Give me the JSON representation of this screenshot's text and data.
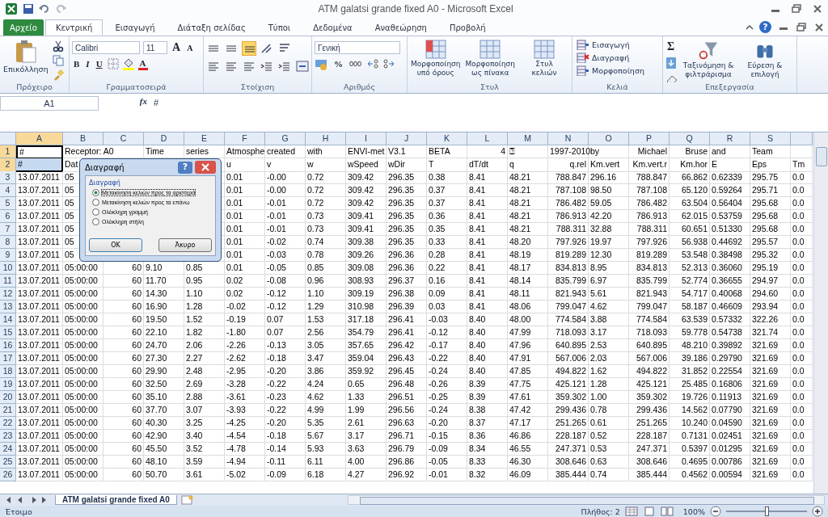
{
  "window": {
    "title": "ATM galatsi grande fixed A0  -  Microsoft Excel"
  },
  "file_tab": "Αρχείο",
  "tabs": [
    {
      "label": "Κεντρική",
      "selected": true
    },
    {
      "label": "Εισαγωγή",
      "selected": false
    },
    {
      "label": "Διάταξη σελίδας",
      "selected": false
    },
    {
      "label": "Τύποι",
      "selected": false
    },
    {
      "label": "Δεδομένα",
      "selected": false
    },
    {
      "label": "Αναθεώρηση",
      "selected": false
    },
    {
      "label": "Προβολή",
      "selected": false
    }
  ],
  "help": "?",
  "ribbon": {
    "clipboard": {
      "label": "Πρόχειρο",
      "paste": "Επικόλληση"
    },
    "font": {
      "label": "Γραμματοσειρά",
      "name": "Calibri",
      "size": "11",
      "grow": "A",
      "shrink": "A",
      "bold": "B",
      "italic": "I",
      "underline": "U",
      "font_color_button": "A"
    },
    "alignment": {
      "label": "Στοίχιση"
    },
    "number": {
      "label": "Αριθμός",
      "format": "Γενική",
      "percent": "%",
      "thousands": "000"
    },
    "styles": {
      "label": "Στυλ",
      "buttons": [
        "Μορφοποίηση\nυπό όρους",
        "Μορφοποίηση\nως πίνακα",
        "Στυλ\nκελιών"
      ]
    },
    "cells": {
      "label": "Κελιά",
      "buttons": [
        "Εισαγωγή",
        "Διαγραφή",
        "Μορφοποίηση"
      ]
    },
    "editing": {
      "label": "Επεξεργασία",
      "sum": "Σ",
      "buttons": [
        "Ταξινόμηση &\nφιλτράρισμα",
        "Εύρεση &\nεπιλογή"
      ]
    }
  },
  "formula_bar": {
    "name_box": "A1",
    "fx": "fx",
    "value": "#"
  },
  "columns": [
    {
      "letter": "A",
      "selected": true
    },
    {
      "letter": "B",
      "selected": false
    },
    {
      "letter": "C",
      "selected": false
    },
    {
      "letter": "D",
      "selected": false
    },
    {
      "letter": "E",
      "selected": false
    },
    {
      "letter": "F",
      "selected": false
    },
    {
      "letter": "G",
      "selected": false
    },
    {
      "letter": "H",
      "selected": false
    },
    {
      "letter": "I",
      "selected": false
    },
    {
      "letter": "J",
      "selected": false
    },
    {
      "letter": "K",
      "selected": false
    },
    {
      "letter": "L",
      "selected": false
    },
    {
      "letter": "M",
      "selected": false
    },
    {
      "letter": "N",
      "selected": false
    },
    {
      "letter": "O",
      "selected": false
    },
    {
      "letter": "P",
      "selected": false
    },
    {
      "letter": "Q",
      "selected": false
    },
    {
      "letter": "R",
      "selected": false
    },
    {
      "letter": "S",
      "selected": false
    }
  ],
  "rows": [
    {
      "number": "1",
      "selected": true,
      "cells": [
        "#",
        "Receptor: A0",
        null,
        "Time",
        "series",
        "Atmosphe",
        "created",
        "with",
        "ENVI-met",
        "V3.1",
        "BETA",
        "4",
        "⍰",
        "1997-2010",
        "by",
        "Michael",
        "Bruse",
        "and",
        "Team",
        null
      ]
    },
    {
      "number": "2",
      "selected": true,
      "cells": [
        "#",
        "Dat",
        null,
        null,
        null,
        "u",
        "v",
        "w",
        "wSpeed",
        "wDir",
        "T",
        "dT/dt",
        "q",
        "q.rel",
        "Km.vert",
        "Km.vert.r",
        "Km.hor",
        "E",
        "Eps",
        "Tm"
      ]
    },
    {
      "number": "3",
      "selected": false,
      "cells": [
        "13.07.2011",
        "05",
        null,
        null,
        null,
        "0.01",
        "-0.00",
        "0.72",
        "309.42",
        "296.35",
        "0.38",
        "8.41",
        "48.21",
        "788.847",
        "296.16",
        "788.847",
        "66.862",
        "0.62339",
        "295.75",
        "0.0"
      ]
    },
    {
      "number": "4",
      "selected": false,
      "cells": [
        "13.07.2011",
        "05",
        null,
        null,
        null,
        "0.01",
        "-0.00",
        "0.72",
        "309.42",
        "296.35",
        "0.37",
        "8.41",
        "48.21",
        "787.108",
        "98.50",
        "787.108",
        "65.120",
        "0.59264",
        "295.71",
        "0.0"
      ]
    },
    {
      "number": "5",
      "selected": false,
      "cells": [
        "13.07.2011",
        "05",
        null,
        null,
        null,
        "0.01",
        "-0.01",
        "0.72",
        "309.42",
        "296.35",
        "0.37",
        "8.41",
        "48.21",
        "786.482",
        "59.05",
        "786.482",
        "63.504",
        "0.56404",
        "295.68",
        "0.0"
      ]
    },
    {
      "number": "6",
      "selected": false,
      "cells": [
        "13.07.2011",
        "05",
        null,
        null,
        null,
        "0.01",
        "-0.01",
        "0.73",
        "309.41",
        "296.35",
        "0.36",
        "8.41",
        "48.21",
        "786.913",
        "42.20",
        "786.913",
        "62.015",
        "0.53759",
        "295.68",
        "0.0"
      ]
    },
    {
      "number": "7",
      "selected": false,
      "cells": [
        "13.07.2011",
        "05",
        null,
        null,
        null,
        "0.01",
        "-0.01",
        "0.73",
        "309.41",
        "296.35",
        "0.35",
        "8.41",
        "48.21",
        "788.311",
        "32.88",
        "788.311",
        "60.651",
        "0.51330",
        "295.68",
        "0.0"
      ]
    },
    {
      "number": "8",
      "selected": false,
      "cells": [
        "13.07.2011",
        "05",
        null,
        null,
        null,
        "0.01",
        "-0.02",
        "0.74",
        "309.38",
        "296.35",
        "0.33",
        "8.41",
        "48.20",
        "797.926",
        "19.97",
        "797.926",
        "56.938",
        "0.44692",
        "295.57",
        "0.0"
      ]
    },
    {
      "number": "9",
      "selected": false,
      "cells": [
        "13.07.2011",
        "05",
        null,
        null,
        null,
        "0.01",
        "-0.03",
        "0.78",
        "309.26",
        "296.36",
        "0.28",
        "8.41",
        "48.19",
        "819.289",
        "12.30",
        "819.289",
        "53.548",
        "0.38498",
        "295.32",
        "0.0"
      ]
    },
    {
      "number": "10",
      "selected": false,
      "cells": [
        "13.07.2011",
        "05:00:00",
        "60",
        "9.10",
        "0.85",
        "0.01",
        "-0.05",
        "0.85",
        "309.08",
        "296.36",
        "0.22",
        "8.41",
        "48.17",
        "834.813",
        "8.95",
        "834.813",
        "52.313",
        "0.36060",
        "295.19",
        "0.0"
      ]
    },
    {
      "number": "11",
      "selected": false,
      "cells": [
        "13.07.2011",
        "05:00:00",
        "60",
        "11.70",
        "0.95",
        "0.02",
        "-0.08",
        "0.96",
        "308.93",
        "296.37",
        "0.16",
        "8.41",
        "48.14",
        "835.799",
        "6.97",
        "835.799",
        "52.774",
        "0.36655",
        "294.97",
        "0.0"
      ]
    },
    {
      "number": "12",
      "selected": false,
      "cells": [
        "13.07.2011",
        "05:00:00",
        "60",
        "14.30",
        "1.10",
        "0.02",
        "-0.12",
        "1.10",
        "309.19",
        "296.38",
        "0.09",
        "8.41",
        "48.11",
        "821.943",
        "5.61",
        "821.943",
        "54.717",
        "0.40068",
        "294.60",
        "0.0"
      ]
    },
    {
      "number": "13",
      "selected": false,
      "cells": [
        "13.07.2011",
        "05:00:00",
        "60",
        "16.90",
        "1.28",
        "-0.02",
        "-0.12",
        "1.29",
        "310.98",
        "296.39",
        "0.03",
        "8.41",
        "48.06",
        "799.047",
        "4.62",
        "799.047",
        "58.187",
        "0.46609",
        "293.94",
        "0.0"
      ]
    },
    {
      "number": "14",
      "selected": false,
      "cells": [
        "13.07.2011",
        "05:00:00",
        "60",
        "19.50",
        "1.52",
        "-0.19",
        "0.07",
        "1.53",
        "317.18",
        "296.41",
        "-0.03",
        "8.40",
        "48.00",
        "774.584",
        "3.88",
        "774.584",
        "63.539",
        "0.57332",
        "322.26",
        "0.0"
      ]
    },
    {
      "number": "15",
      "selected": false,
      "cells": [
        "13.07.2011",
        "05:00:00",
        "60",
        "22.10",
        "1.82",
        "-1.80",
        "0.07",
        "2.56",
        "354.79",
        "296.41",
        "-0.12",
        "8.40",
        "47.99",
        "718.093",
        "3.17",
        "718.093",
        "59.778",
        "0.54738",
        "321.74",
        "0.0"
      ]
    },
    {
      "number": "16",
      "selected": false,
      "cells": [
        "13.07.2011",
        "05:00:00",
        "60",
        "24.70",
        "2.06",
        "-2.26",
        "-0.13",
        "3.05",
        "357.65",
        "296.42",
        "-0.17",
        "8.40",
        "47.96",
        "640.895",
        "2.53",
        "640.895",
        "48.210",
        "0.39892",
        "321.69",
        "0.0"
      ]
    },
    {
      "number": "17",
      "selected": false,
      "cells": [
        "13.07.2011",
        "05:00:00",
        "60",
        "27.30",
        "2.27",
        "-2.62",
        "-0.18",
        "3.47",
        "359.04",
        "296.43",
        "-0.22",
        "8.40",
        "47.91",
        "567.006",
        "2.03",
        "567.006",
        "39.186",
        "0.29790",
        "321.69",
        "0.0"
      ]
    },
    {
      "number": "18",
      "selected": false,
      "cells": [
        "13.07.2011",
        "05:00:00",
        "60",
        "29.90",
        "2.48",
        "-2.95",
        "-0.20",
        "3.86",
        "359.92",
        "296.45",
        "-0.24",
        "8.40",
        "47.85",
        "494.822",
        "1.62",
        "494.822",
        "31.852",
        "0.22554",
        "321.69",
        "0.0"
      ]
    },
    {
      "number": "19",
      "selected": false,
      "cells": [
        "13.07.2011",
        "05:00:00",
        "60",
        "32.50",
        "2.69",
        "-3.28",
        "-0.22",
        "4.24",
        "0.65",
        "296.48",
        "-0.26",
        "8.39",
        "47.75",
        "425.121",
        "1.28",
        "425.121",
        "25.485",
        "0.16806",
        "321.69",
        "0.0"
      ]
    },
    {
      "number": "20",
      "selected": false,
      "cells": [
        "13.07.2011",
        "05:00:00",
        "60",
        "35.10",
        "2.88",
        "-3.61",
        "-0.23",
        "4.62",
        "1.33",
        "296.51",
        "-0.25",
        "8.39",
        "47.61",
        "359.302",
        "1.00",
        "359.302",
        "19.726",
        "0.11913",
        "321.69",
        "0.0"
      ]
    },
    {
      "number": "21",
      "selected": false,
      "cells": [
        "13.07.2011",
        "05:00:00",
        "60",
        "37.70",
        "3.07",
        "-3.93",
        "-0.22",
        "4.99",
        "1.99",
        "296.56",
        "-0.24",
        "8.38",
        "47.42",
        "299.436",
        "0.78",
        "299.436",
        "14.562",
        "0.07790",
        "321.69",
        "0.0"
      ]
    },
    {
      "number": "22",
      "selected": false,
      "cells": [
        "13.07.2011",
        "05:00:00",
        "60",
        "40.30",
        "3.25",
        "-4.25",
        "-0.20",
        "5.35",
        "2.61",
        "296.63",
        "-0.20",
        "8.37",
        "47.17",
        "251.265",
        "0.61",
        "251.265",
        "10.240",
        "0.04590",
        "321.69",
        "0.0"
      ]
    },
    {
      "number": "23",
      "selected": false,
      "cells": [
        "13.07.2011",
        "05:00:00",
        "60",
        "42.90",
        "3.40",
        "-4.54",
        "-0.18",
        "5.67",
        "3.17",
        "296.71",
        "-0.15",
        "8.36",
        "46.86",
        "228.187",
        "0.52",
        "228.187",
        "0.7131",
        "0.02451",
        "321.69",
        "0.0"
      ]
    },
    {
      "number": "24",
      "selected": false,
      "cells": [
        "13.07.2011",
        "05:00:00",
        "60",
        "45.50",
        "3.52",
        "-4.78",
        "-0.14",
        "5.93",
        "3.63",
        "296.79",
        "-0.09",
        "8.34",
        "46.55",
        "247.371",
        "0.53",
        "247.371",
        "0.5397",
        "0.01295",
        "321.69",
        "0.0"
      ]
    },
    {
      "number": "25",
      "selected": false,
      "cells": [
        "13.07.2011",
        "05:00:00",
        "60",
        "48.10",
        "3.59",
        "-4.94",
        "-0.11",
        "6.11",
        "4.00",
        "296.86",
        "-0.05",
        "8.33",
        "46.30",
        "308.646",
        "0.63",
        "308.646",
        "0.4695",
        "0.00786",
        "321.69",
        "0.0"
      ]
    },
    {
      "number": "26",
      "selected": false,
      "cells": [
        "13.07.2011",
        "05:00:00",
        "60",
        "50.70",
        "3.61",
        "-5.02",
        "-0.09",
        "6.18",
        "4.27",
        "296.92",
        "-0.01",
        "8.32",
        "46.09",
        "385.444",
        "0.74",
        "385.444",
        "0.4562",
        "0.00594",
        "321.69",
        "0.0"
      ]
    }
  ],
  "dialog": {
    "title": "Διαγραφή",
    "help": "?",
    "group": "Διαγραφή",
    "options": [
      {
        "label": "Μετακίνηση κελιών προς τα αριστερά",
        "selected": true
      },
      {
        "label": "Μετακίνηση κελιών προς τα επάνω",
        "selected": false
      },
      {
        "label": "Ολόκληρη γραμμή",
        "selected": false
      },
      {
        "label": "Ολόκληρη στήλη",
        "selected": false
      }
    ],
    "buttons": [
      "OK",
      "Άκυρο"
    ]
  },
  "sheet_tab": "ATM galatsi grande fixed A0",
  "status_bar": {
    "state": "Έτοιμο",
    "count": "Πλήθος: 2",
    "zoom": "100%",
    "zoom_level": {
      "level": 0.5
    }
  }
}
